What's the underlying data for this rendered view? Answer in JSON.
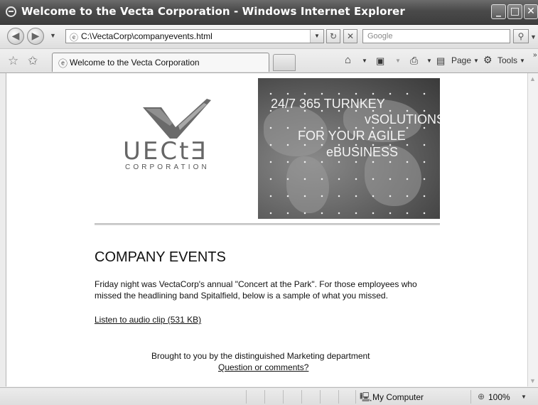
{
  "window": {
    "title": "Welcome to the Vecta Corporation - Windows Internet Explorer",
    "minimize": "_",
    "maximize": "□",
    "close": "✕"
  },
  "navigation": {
    "back_glyph": "◀",
    "forward_glyph": "▶",
    "address": "C:\\VectaCorp\\companyevents.html",
    "search_placeholder": "Google",
    "refresh_glyph": "↻",
    "stop_glyph": "✕",
    "search_glyph": "⚲"
  },
  "tabs": {
    "active_label": "Welcome to the Vecta Corporation"
  },
  "command_bar": {
    "page_label": "Page",
    "tools_label": "Tools"
  },
  "page": {
    "logo": {
      "wordmark": "UECtƎ",
      "subtitle": "CORPORATION"
    },
    "banner": {
      "line1": "24/7 365 TURNKEY",
      "line2": "vSOLUTIONS",
      "line3": "FOR YOUR AGILE",
      "line4": "eBUSINESS"
    },
    "heading": "COMPANY EVENTS",
    "paragraph": "Friday night was VectaCorp's annual \"Concert at the Park\". For those employees who missed the headlining band Spitalfield, below is a sample of what you missed.",
    "audio_link": "Listen to audio clip (531 KB)",
    "footer_text": "Brought to you by the distinguished Marketing department",
    "footer_link": "Question or comments?"
  },
  "status_bar": {
    "zone": "My Computer",
    "zoom": "100%"
  },
  "icons": {
    "ie": "ie-logo-icon",
    "favorites": "favorites-star-icon",
    "add_favorites": "add-favorites-icon",
    "home": "home-icon",
    "feeds": "feeds-icon",
    "print": "print-icon",
    "page": "page-icon",
    "tools": "gear-icon",
    "computer": "computer-icon",
    "zoom": "magnifier-icon"
  }
}
